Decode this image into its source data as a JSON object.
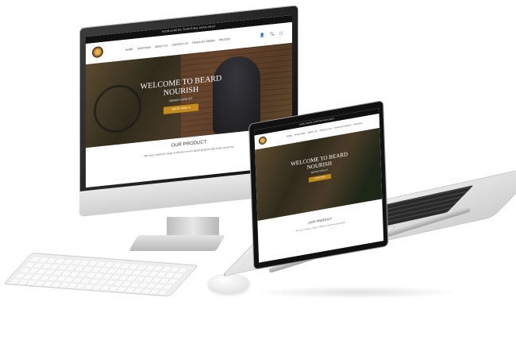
{
  "desktop": {
    "promo_text": "WORLDWIDE SHIPPING AVAILABLE",
    "nav": [
      "HOME",
      "SHOP NOW",
      "ABOUT US",
      "CONTACT US",
      "TRACK MY ORDER",
      "POLICIES"
    ],
    "hero": {
      "title": "WELCOME TO BEARD NOURISH",
      "subtitle": "BEARD CARE KIT",
      "button": "SHOP NOW ➔"
    },
    "product": {
      "heading": "OUR PRODUCT",
      "text": "We have created a range of effective men's beard products and beard grooming"
    },
    "icons": [
      "user-icon",
      "search-icon",
      "cart-icon"
    ]
  },
  "laptop": {
    "promo_text": "WORLDWIDE SHIPPING AVAILABLE",
    "nav": [
      "HOME",
      "SHOP NOW",
      "ABOUT US",
      "CONTACT US",
      "TRACK MY ORDER",
      "POLICIES"
    ],
    "hero": {
      "title": "WELCOME TO BEARD NOURISH",
      "subtitle": "BEARD CARE KIT",
      "button": "SHOP NOW"
    },
    "product": {
      "heading": "OUR PRODUCT",
      "text": "We have created a range of effective men's beard products"
    }
  },
  "colors": {
    "accent": "#c58a1c",
    "header_bar": "#111111"
  }
}
